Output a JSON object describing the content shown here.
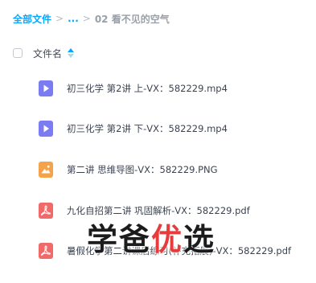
{
  "breadcrumb": {
    "root": "全部文件",
    "ellipsis": "...",
    "current": "02 看不见的空气",
    "separator": ">"
  },
  "list_header": {
    "column_name": "文件名",
    "sort_icon": "sort-asc-icon"
  },
  "files": [
    {
      "name": "初三化学 第2讲 上-VX：582229.mp4",
      "type": "video",
      "icon": "video-file-icon",
      "color": "#7b7bf3"
    },
    {
      "name": "初三化学 第2讲 下-VX：582229.mp4",
      "type": "video",
      "icon": "video-file-icon",
      "color": "#7b7bf3"
    },
    {
      "name": "第二讲 思维导图-VX：582229.PNG",
      "type": "image",
      "icon": "image-file-icon",
      "color": "#f5a34a"
    },
    {
      "name": "九化自招第二讲 巩固解析-VX：582229.pdf",
      "type": "pdf",
      "icon": "pdf-file-icon",
      "color": "#f06a6a"
    },
    {
      "name": "暑假化学第二讲课后练习(补充拓展)-VX：582229.pdf",
      "type": "pdf",
      "icon": "pdf-file-icon",
      "color": "#f06a6a"
    }
  ],
  "watermark": {
    "part1": "学爸",
    "part2": "优",
    "part3": "选"
  },
  "colors": {
    "accent": "#06a7ff",
    "watermark_red": "#e83b3b"
  }
}
